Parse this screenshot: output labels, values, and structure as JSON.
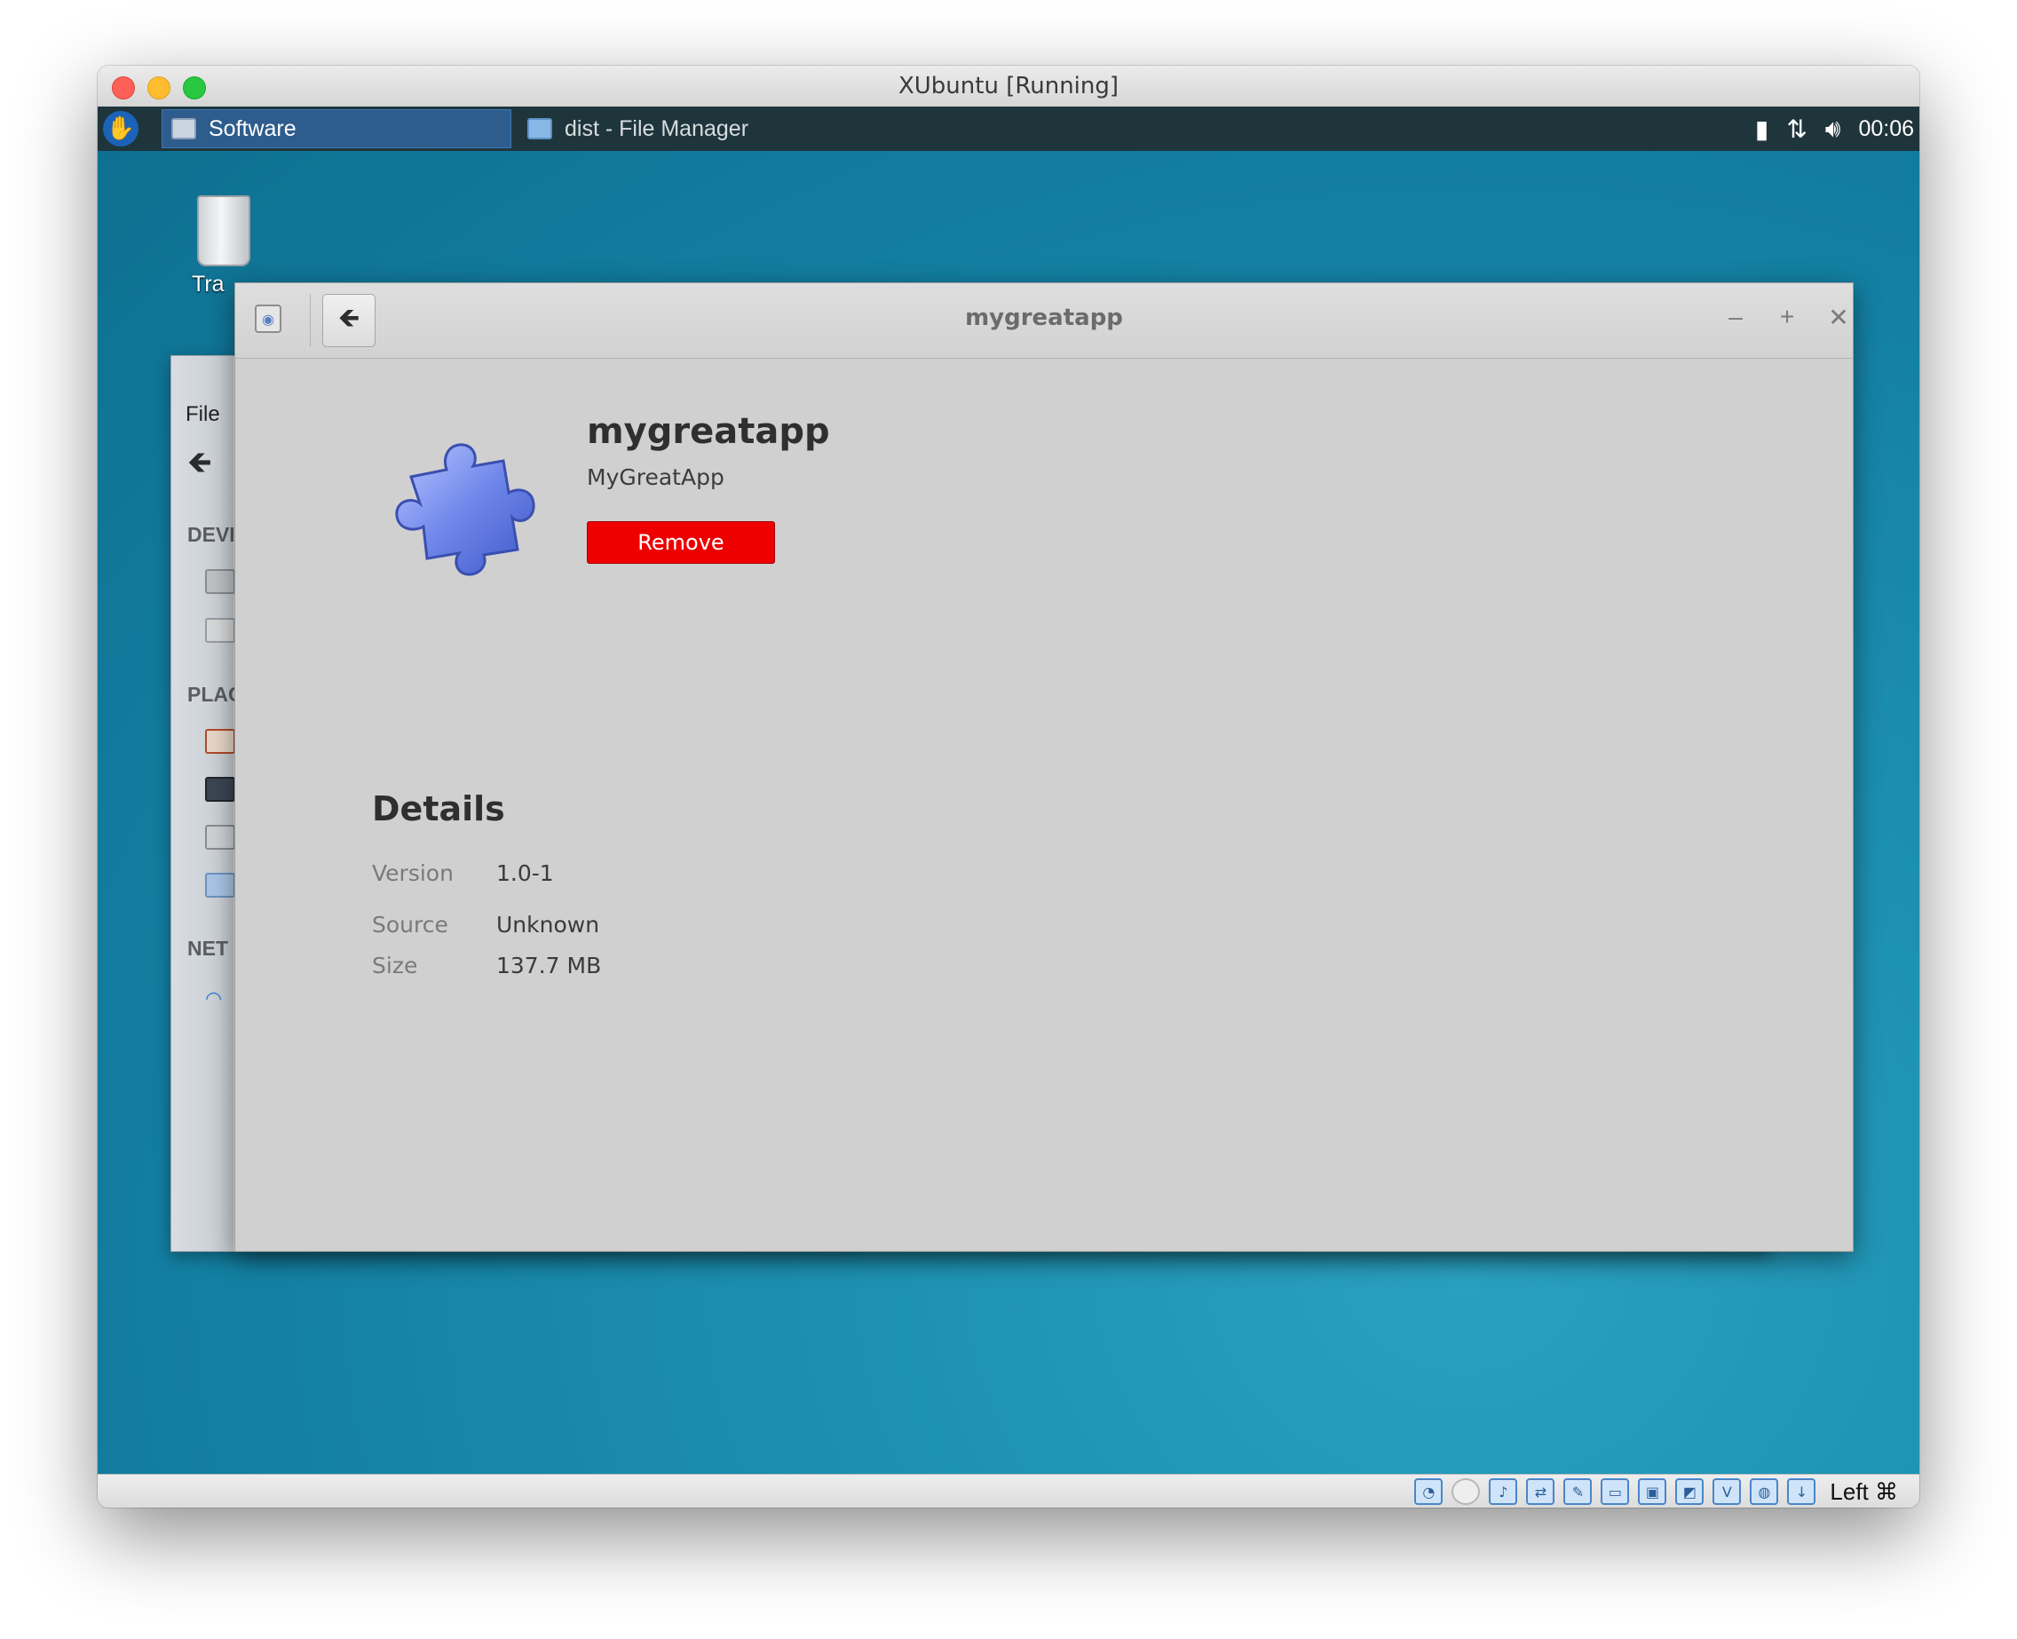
{
  "vm": {
    "window_title": "XUbuntu [Running]"
  },
  "panel": {
    "tasks": [
      {
        "label": "Software",
        "active": true
      },
      {
        "label": "dist - File Manager",
        "active": false
      }
    ],
    "tray": {
      "battery_icon": "battery-icon",
      "network_icon": "network-transfer-icon",
      "volume_icon": "volume-icon",
      "clock": "00:06"
    }
  },
  "desktop": {
    "trash_label": "Tra"
  },
  "file_manager": {
    "menu_file": "File",
    "sections": [
      "DEVI",
      "PLAC",
      "NET"
    ]
  },
  "software_window": {
    "title": "mygreatapp",
    "app": {
      "name": "mygreatapp",
      "summary": "MyGreatApp",
      "icon": "puzzle-piece-icon",
      "remove_label": "Remove",
      "remove_color": "#ee0000"
    },
    "details": {
      "heading": "Details",
      "rows": [
        {
          "key": "Version",
          "value": "1.0-1"
        },
        {
          "key": "Source",
          "value": "Unknown"
        },
        {
          "key": "Size",
          "value": "137.7 MB"
        }
      ]
    }
  },
  "vbox_status": {
    "host_key": "Left ⌘"
  }
}
